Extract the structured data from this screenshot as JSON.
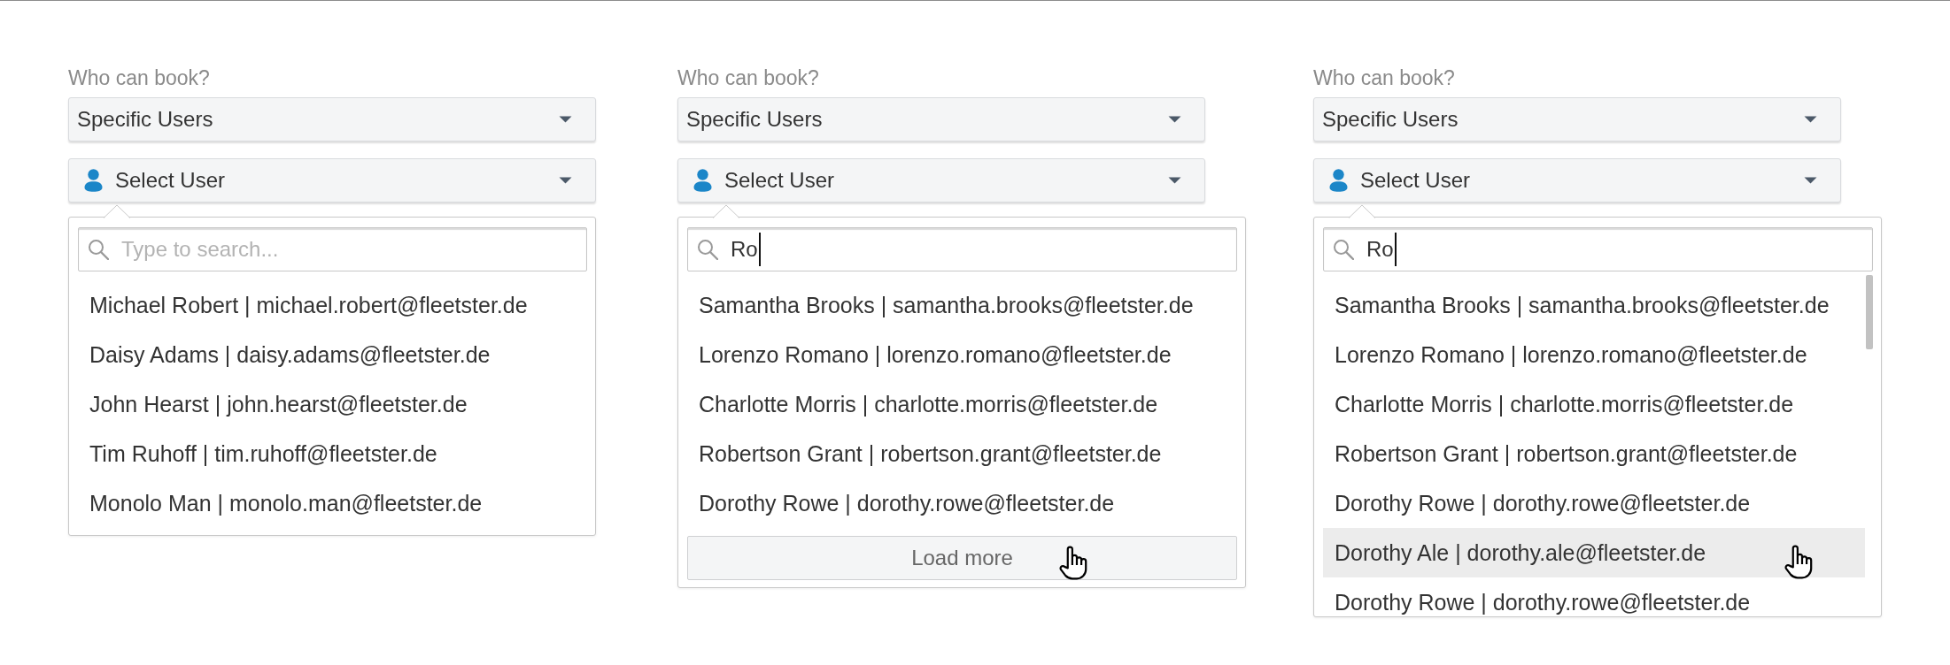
{
  "panels": [
    {
      "label": "Who can book?",
      "access_select": {
        "value": "Specific Users"
      },
      "user_select": {
        "text": "Select User"
      },
      "dropdown": {
        "search": {
          "placeholder": "Type to search...",
          "focused": false
        },
        "scrollable": false,
        "options": [
          {
            "label": "Michael Robert | michael.robert@fleetster.de",
            "highlighted": false
          },
          {
            "label": "Daisy Adams | daisy.adams@fleetster.de",
            "highlighted": false
          },
          {
            "label": "John Hearst | john.hearst@fleetster.de",
            "highlighted": false
          },
          {
            "label": "Tim Ruhoff | tim.ruhoff@fleetster.de",
            "highlighted": false
          },
          {
            "label": "Monolo Man | monolo.man@fleetster.de",
            "highlighted": false
          }
        ]
      }
    },
    {
      "label": "Who can book?",
      "access_select": {
        "value": "Specific Users"
      },
      "user_select": {
        "text": "Select User"
      },
      "dropdown": {
        "search": {
          "value": "Ro",
          "focused": true
        },
        "scrollable": false,
        "options": [
          {
            "label": "Samantha Brooks | samantha.brooks@fleetster.de",
            "highlighted": false
          },
          {
            "label": "Lorenzo Romano | lorenzo.romano@fleetster.de",
            "highlighted": false
          },
          {
            "label": "Charlotte Morris | charlotte.morris@fleetster.de",
            "highlighted": false
          },
          {
            "label": "Robertson Grant | robertson.grant@fleetster.de",
            "highlighted": false
          },
          {
            "label": "Dorothy Rowe | dorothy.rowe@fleetster.de",
            "highlighted": false
          }
        ],
        "load_more": {
          "label": "Load more",
          "hovered": true
        }
      }
    },
    {
      "label": "Who can book?",
      "access_select": {
        "value": "Specific Users"
      },
      "user_select": {
        "text": "Select User"
      },
      "dropdown": {
        "search": {
          "value": "Ro",
          "focused": true
        },
        "scrollable": true,
        "options": [
          {
            "label": "Samantha Brooks | samantha.brooks@fleetster.de",
            "highlighted": false
          },
          {
            "label": "Lorenzo Romano | lorenzo.romano@fleetster.de",
            "highlighted": false
          },
          {
            "label": "Charlotte Morris | charlotte.morris@fleetster.de",
            "highlighted": false
          },
          {
            "label": "Robertson Grant | robertson.grant@fleetster.de",
            "highlighted": false
          },
          {
            "label": "Dorothy Rowe | dorothy.rowe@fleetster.de",
            "highlighted": false
          },
          {
            "label": "Dorothy Ale | dorothy.ale@fleetster.de",
            "highlighted": true
          },
          {
            "label": "Dorothy Rowe | dorothy.rowe@fleetster.de",
            "highlighted": false
          }
        ]
      }
    }
  ]
}
